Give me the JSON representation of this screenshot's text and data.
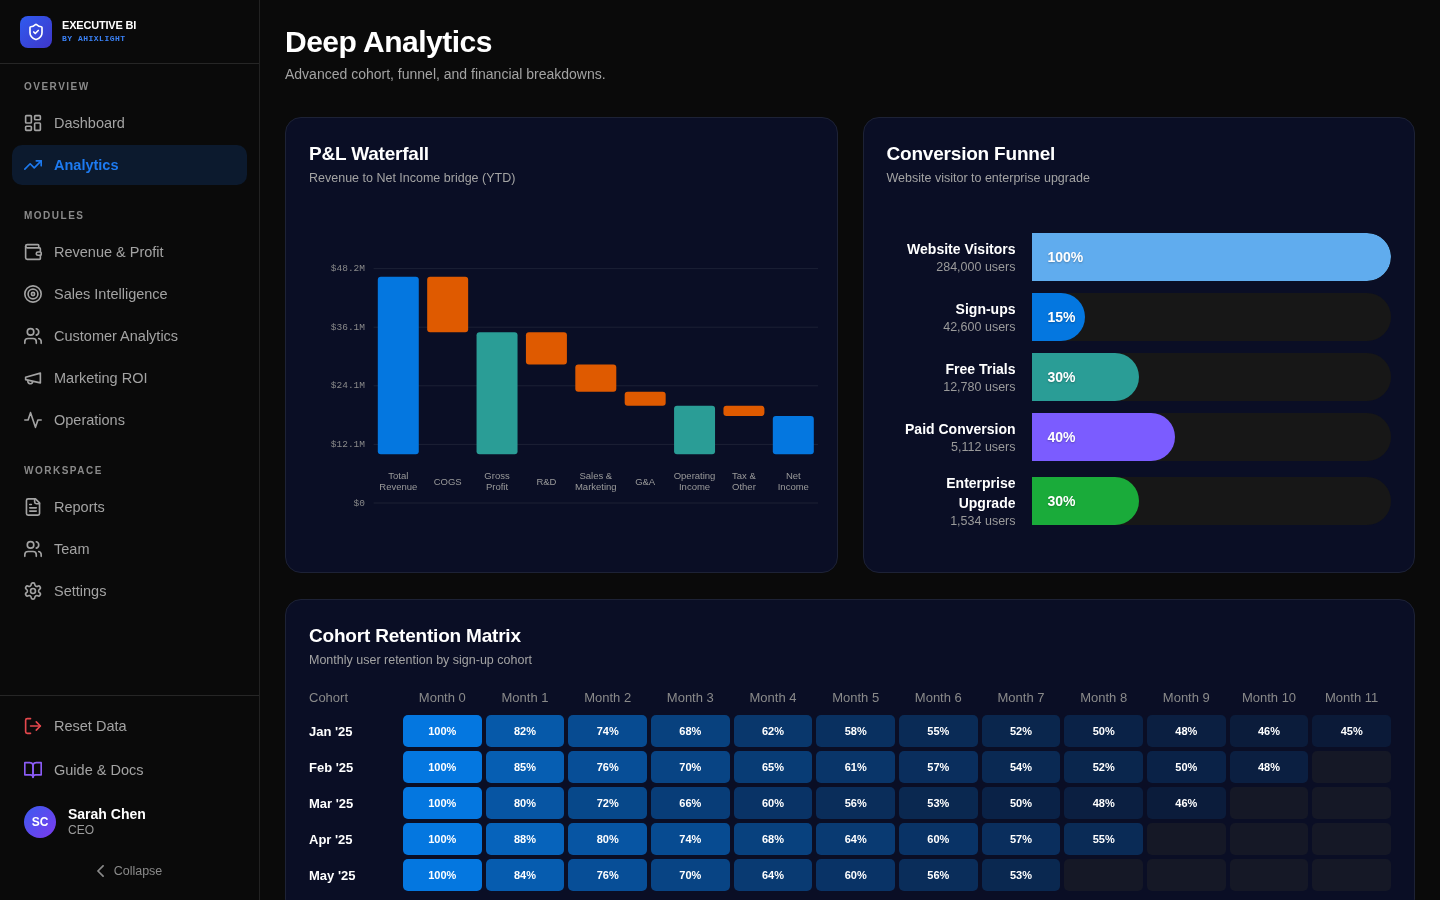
{
  "sidebar": {
    "brand": {
      "name": "EXECUTIVE BI",
      "tagline": "BY AHIXLIGHT"
    },
    "sections": [
      {
        "label": "OVERVIEW",
        "items": [
          {
            "label": "Dashboard",
            "selected": false
          },
          {
            "label": "Analytics",
            "selected": true
          }
        ]
      },
      {
        "label": "MODULES",
        "items": [
          {
            "label": "Revenue & Profit",
            "selected": false
          },
          {
            "label": "Sales Intelligence",
            "selected": false
          },
          {
            "label": "Customer Analytics",
            "selected": false
          },
          {
            "label": "Marketing ROI",
            "selected": false
          },
          {
            "label": "Operations",
            "selected": false
          }
        ]
      },
      {
        "label": "WORKSPACE",
        "items": [
          {
            "label": "Reports",
            "selected": false
          },
          {
            "label": "Team",
            "selected": false
          },
          {
            "label": "Settings",
            "selected": false
          }
        ]
      }
    ],
    "actions": [
      {
        "label": "Reset Data"
      },
      {
        "label": "Guide & Docs"
      }
    ],
    "user": {
      "initials": "SC",
      "name": "Sarah Chen",
      "role": "CEO"
    },
    "collapse": {
      "label": "Collapse"
    }
  },
  "header": {
    "title": "Deep Analytics",
    "subtitle": "Advanced cohort, funnel, and financial breakdowns."
  },
  "waterfall": {
    "title": "P&L Waterfall",
    "subtitle": "Revenue to Net Income bridge (YTD)",
    "chart_data": {
      "type": "bar",
      "categories": [
        "Total Revenue",
        "COGS",
        "Gross Profit",
        "R&D",
        "Sales & Marketing",
        "G&A",
        "Operating Income",
        "Tax & Other",
        "Net Income"
      ],
      "series": [
        {
          "color": "#0477e0",
          "values": [
            36.5,
            null,
            null,
            null,
            null,
            null,
            null,
            null,
            7.9
          ],
          "base": [
            10.0,
            null,
            null,
            null,
            null,
            null,
            null,
            null,
            10.0
          ]
        },
        {
          "color": "#df5a00",
          "values": [
            null,
            11.4,
            null,
            6.6,
            5.6,
            2.9,
            null,
            2.1,
            null
          ],
          "base": [
            null,
            35.1,
            null,
            28.5,
            22.9,
            20.0,
            null,
            17.9,
            null
          ]
        },
        {
          "color": "#2a9d96",
          "values": [
            null,
            null,
            25.1,
            null,
            null,
            null,
            10.0,
            null,
            null
          ],
          "base": [
            null,
            null,
            10.0,
            null,
            null,
            null,
            10.0,
            null,
            null
          ]
        }
      ],
      "ylim": [
        0,
        48.2
      ],
      "yticks": [
        {
          "value": 0,
          "label": "$0"
        },
        {
          "value": 12.05,
          "label": "$12.1M"
        },
        {
          "value": 24.1,
          "label": "$24.1M"
        },
        {
          "value": 36.15,
          "label": "$36.1M"
        },
        {
          "value": 48.2,
          "label": "$48.2M"
        }
      ],
      "grid": true
    }
  },
  "funnel": {
    "title": "Conversion Funnel",
    "subtitle": "Website visitor to enterprise upgrade",
    "stages": [
      {
        "name": "Website Visitors",
        "users": "284,000 users",
        "percent": "100%",
        "level": 1.0,
        "color": "#60acee"
      },
      {
        "name": "Sign-ups",
        "users": "42,600 users",
        "percent": "15%",
        "level": 0.15,
        "color": "#0477e0"
      },
      {
        "name": "Free Trials",
        "users": "12,780 users",
        "percent": "30%",
        "level": 0.3,
        "color": "#2a9d96"
      },
      {
        "name": "Paid Conversion",
        "users": "5,112 users",
        "percent": "40%",
        "level": 0.4,
        "color": "#7b5cff"
      },
      {
        "name": "Enterprise Upgrade",
        "users": "1,534 users",
        "percent": "30%",
        "level": 0.3,
        "color": "#1aab3a"
      }
    ]
  },
  "cohort": {
    "title": "Cohort Retention Matrix",
    "subtitle": "Monthly user retention by sign-up cohort",
    "columns": [
      "Cohort",
      "Month 0",
      "Month 1",
      "Month 2",
      "Month 3",
      "Month 4",
      "Month 5",
      "Month 6",
      "Month 7",
      "Month 8",
      "Month 9",
      "Month 10",
      "Month 11"
    ],
    "rows": [
      {
        "cells": [
          {
            "value": "Jan '25"
          },
          {
            "value": "100%",
            "color": "#0477e0"
          },
          {
            "value": "82%",
            "color": "#0659a9"
          },
          {
            "value": "74%",
            "color": "#074b91"
          },
          {
            "value": "68%",
            "color": "#08417e"
          },
          {
            "value": "62%",
            "color": "#09376c"
          },
          {
            "value": "58%",
            "color": "#093060"
          },
          {
            "value": "55%",
            "color": "#0a2b56"
          },
          {
            "value": "52%",
            "color": "#0a264d"
          },
          {
            "value": "50%",
            "color": "#0a2247"
          },
          {
            "value": "48%",
            "color": "#0b1f41"
          },
          {
            "value": "46%",
            "color": "#0b1c3b"
          },
          {
            "value": "45%",
            "color": "#0b1a38"
          }
        ]
      },
      {
        "cells": [
          {
            "value": "Feb '25"
          },
          {
            "value": "100%",
            "color": "#0477e0"
          },
          {
            "value": "85%",
            "color": "#065eb2"
          },
          {
            "value": "76%",
            "color": "#074e97"
          },
          {
            "value": "70%",
            "color": "#084484"
          },
          {
            "value": "65%",
            "color": "#083c75"
          },
          {
            "value": "61%",
            "color": "#093569"
          },
          {
            "value": "57%",
            "color": "#0a2e5d"
          },
          {
            "value": "54%",
            "color": "#0a2953"
          },
          {
            "value": "52%",
            "color": "#0a264d"
          },
          {
            "value": "50%",
            "color": "#0a2247"
          },
          {
            "value": "48%",
            "color": "#0b1f41"
          }
        ]
      },
      {
        "cells": [
          {
            "value": "Mar '25"
          },
          {
            "value": "100%",
            "color": "#0477e0"
          },
          {
            "value": "80%",
            "color": "#0755a3"
          },
          {
            "value": "72%",
            "color": "#07488a"
          },
          {
            "value": "66%",
            "color": "#083d78"
          },
          {
            "value": "60%",
            "color": "#093366"
          },
          {
            "value": "56%",
            "color": "#0a2d5a"
          },
          {
            "value": "53%",
            "color": "#0a2850"
          },
          {
            "value": "50%",
            "color": "#0a2247"
          },
          {
            "value": "48%",
            "color": "#0b1f41"
          },
          {
            "value": "46%",
            "color": "#0b1c3b"
          }
        ]
      },
      {
        "cells": [
          {
            "value": "Apr '25"
          },
          {
            "value": "100%",
            "color": "#0477e0"
          },
          {
            "value": "88%",
            "color": "#0663bb"
          },
          {
            "value": "80%",
            "color": "#0755a3"
          },
          {
            "value": "74%",
            "color": "#074b91"
          },
          {
            "value": "68%",
            "color": "#08417e"
          },
          {
            "value": "64%",
            "color": "#093a72"
          },
          {
            "value": "60%",
            "color": "#093366"
          },
          {
            "value": "57%",
            "color": "#0a2e5d"
          },
          {
            "value": "55%",
            "color": "#0a2b56"
          }
        ]
      },
      {
        "cells": [
          {
            "value": "May '25"
          },
          {
            "value": "100%",
            "color": "#0477e0"
          },
          {
            "value": "84%",
            "color": "#065caf"
          },
          {
            "value": "76%",
            "color": "#074e97"
          },
          {
            "value": "70%",
            "color": "#084484"
          },
          {
            "value": "64%",
            "color": "#093a72"
          },
          {
            "value": "60%",
            "color": "#093366"
          },
          {
            "value": "56%",
            "color": "#0a2d5a"
          },
          {
            "value": "53%",
            "color": "#0a2850"
          }
        ]
      }
    ]
  }
}
